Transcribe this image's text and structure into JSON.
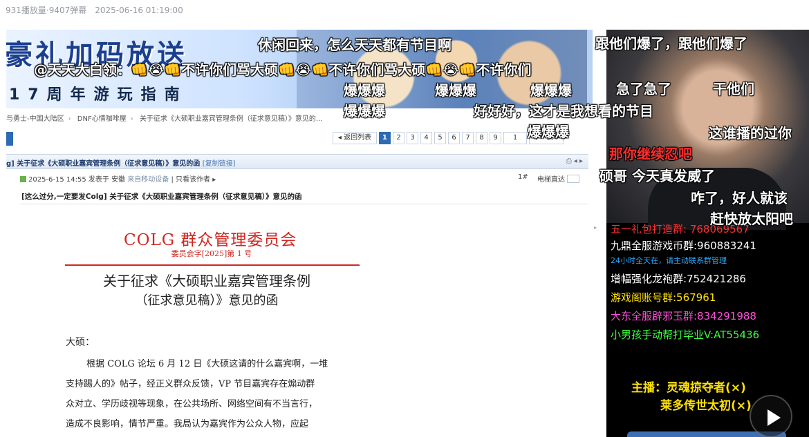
{
  "video_meta": {
    "text": "931播放量·9407弹幕　2025-06-16 01:19:00"
  },
  "forum": {
    "banner": {
      "title": "豪礼加码放送",
      "subtitle": "17周年游玩指南"
    },
    "breadcrumb": [
      "与勇士-中国大陆区",
      "DNF心情咖啡屋",
      "关于征求《大硕职业嘉宾管理条例（征求意见稿）》意见的..."
    ],
    "pagination": {
      "back": "◂ 返回列表",
      "pages": [
        "1",
        "2",
        "3",
        "4",
        "5",
        "6",
        "7",
        "8",
        "9"
      ],
      "current": "1",
      "input": "1",
      "next": "下一页 ▸"
    },
    "thread_title": {
      "prefix": "g] 关于征求《大硕职业嘉宾管理条例（征求意见稿）》意见的函",
      "copy_link": "[复制链接]",
      "icons": "⎙ ◂ ▸"
    },
    "post_meta": {
      "time": "2025-6-15 14:55 发表于 安徽",
      "from": "来自移动设备",
      "sep": "|",
      "author_only": "只看该作者 ▸",
      "floor": "1#",
      "jump": "电梯直达"
    },
    "post_title": "[这么过分,一定要发Colg] 关于征求《大硕职业嘉宾管理条例（征求意见稿）》意见的函",
    "doc": {
      "org": "COLG 群众管理委员会",
      "number": "委员会字[2025]第 1 号",
      "heading1": "关于征求《大硕职业嘉宾管理条例",
      "heading2": "（征求意见稿）》意见的函",
      "salutation": "大硕：",
      "body": [
        "根据 COLG 论坛 6 月 12 日《大硕这请的什么嘉宾啊，一堆",
        "支持踢人的》帖子，经正义群众反馈，VP 节目嘉宾存在煽动群",
        "众对立、学历歧视等现象，在公共场所、网络空间有不当言行，",
        "造成不良影响，情节严重。我局认为嘉宾作为公众人物，应起"
      ]
    }
  },
  "stream_panel": {
    "groups": [
      {
        "text": "五一礼包打造群: 768069567",
        "color": "#ff3030"
      },
      {
        "text": "九鼎全服游戏币群:960883241",
        "color": "#ffffff"
      },
      {
        "text": "24小时全天在，请主动联系群管理",
        "color": "#29a8ff"
      },
      {
        "text": "增幅强化龙袍群:752421286",
        "color": "#ffffff"
      },
      {
        "text": "游戏阁账号群:567961",
        "color": "#ffe100"
      },
      {
        "text": "大东全服辟邪玉群:834291988",
        "color": "#ff4fd8"
      },
      {
        "text": "小男孩手动帮打毕业V:AT55436",
        "color": "#3cff3c"
      }
    ],
    "host_line1": "主播：灵魂掠夺者(×)",
    "host_line2": "莱多传世太初(×)"
  },
  "danmaku": [
    {
      "text": "休闲回来，怎么天天都有节目啊",
      "color": "#ffffff"
    },
    {
      "text": "跟他们爆了，跟他们爆了",
      "color": "#ffffff"
    },
    {
      "text": "@天天大白领：👊😭👊不许你们骂大硕👊😭👊不许你们骂大硕👊😭👊不许你们",
      "color": "#ffffff"
    },
    {
      "text": "爆爆爆",
      "color": "#ffffff"
    },
    {
      "text": "爆爆爆",
      "color": "#ffffff"
    },
    {
      "text": "爆爆爆",
      "color": "#ffffff"
    },
    {
      "text": "急了急了",
      "color": "#ffffff"
    },
    {
      "text": "干他们",
      "color": "#ffffff"
    },
    {
      "text": "爆爆爆",
      "color": "#ffffff"
    },
    {
      "text": "好好好，这才是我想看的节目",
      "color": "#ffffff"
    },
    {
      "text": "爆爆爆",
      "color": "#ffffff"
    },
    {
      "text": "这谁播的过你",
      "color": "#ffffff"
    },
    {
      "text": "那你继续忍吧",
      "color": "#ff2d2d"
    },
    {
      "text": "硕哥 今天真发威了",
      "color": "#ffffff"
    },
    {
      "text": "咋了，好人就该",
      "color": "#ffffff"
    },
    {
      "text": "赶快放太阳吧",
      "color": "#ffffff"
    }
  ],
  "player": {
    "play_icon": "play-icon"
  }
}
